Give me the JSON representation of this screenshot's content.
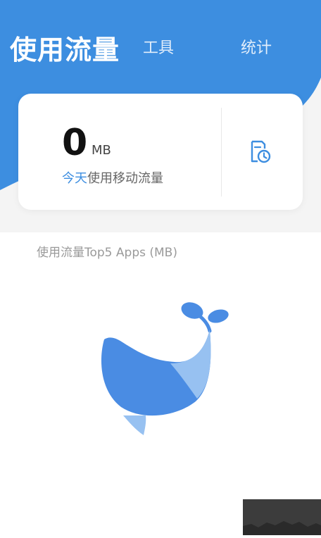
{
  "tabs": {
    "active_label": "使用流量",
    "tools_label": "工具",
    "stats_label": "统计"
  },
  "usage_card": {
    "value": "0",
    "unit": "MB",
    "caption_highlight": "今天",
    "caption_rest": "使用移动流量"
  },
  "history_button": {
    "icon": "history-clock-icon"
  },
  "top_apps": {
    "title": "使用流量Top5 Apps (MB)",
    "empty_illustration": "whale-icon"
  },
  "colors": {
    "primary_blue": "#3d8ee0",
    "whale_dark": "#4a8ce3",
    "whale_light": "#97c1f1"
  }
}
